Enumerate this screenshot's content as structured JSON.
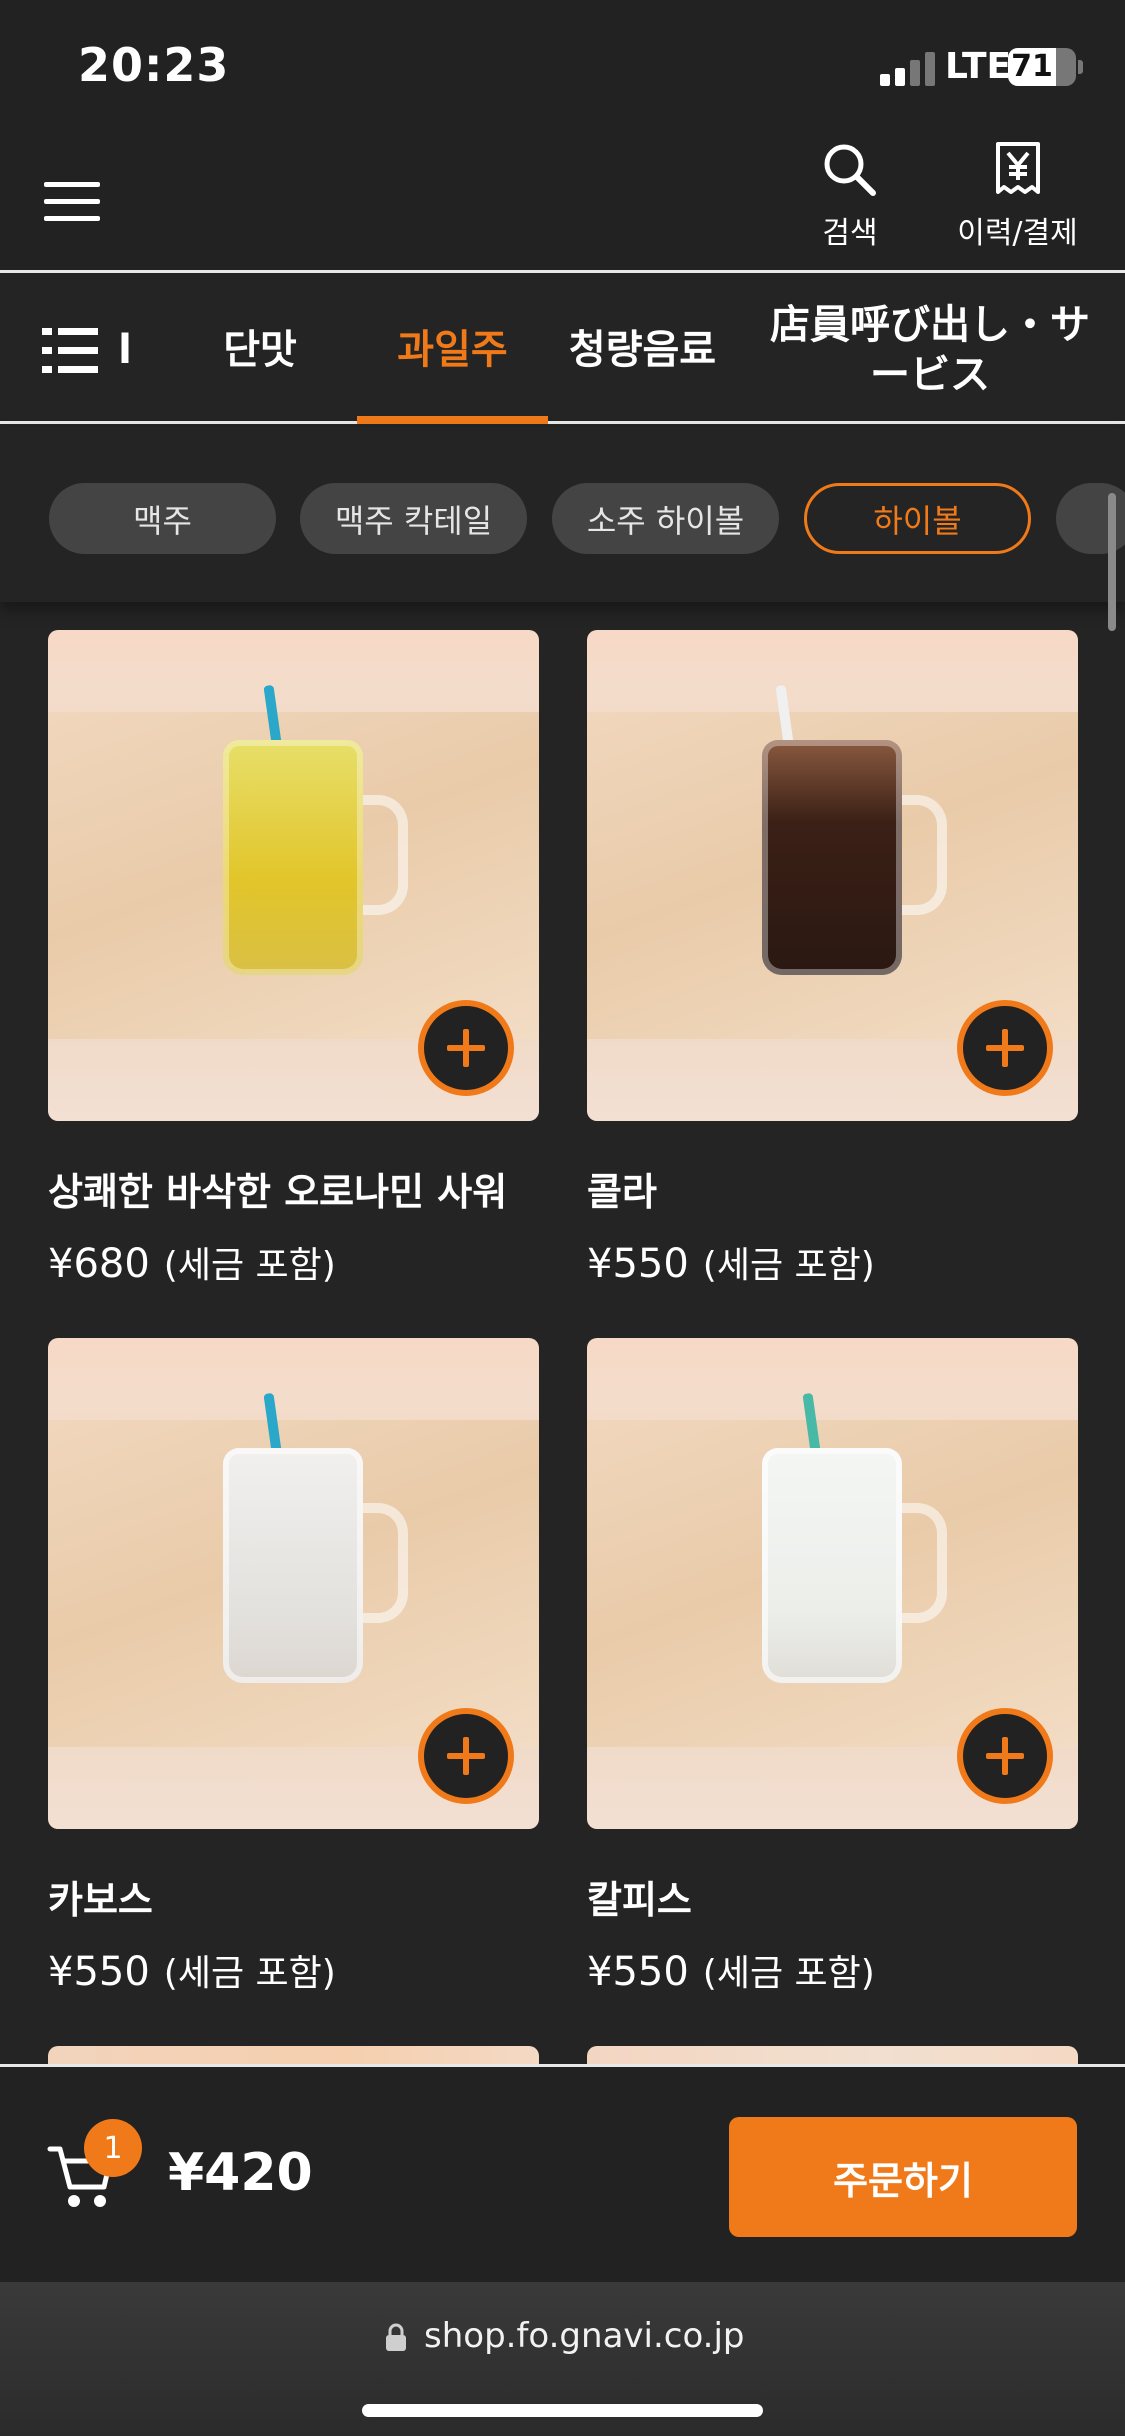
{
  "status_bar": {
    "time": "20:23",
    "network": "LTE",
    "battery": "71",
    "battery_level": 0.71
  },
  "header": {
    "search_label": "검색",
    "history_label": "이력/결제"
  },
  "tabs": {
    "partial_label": "l",
    "items": [
      "단맛",
      "과일주",
      "청량음료",
      "店員呼び出し・サービス"
    ],
    "active_index": 1
  },
  "chips": {
    "items": [
      "맥주",
      "맥주 칵테일",
      "소주 하이볼",
      "하이볼"
    ],
    "active_index": 3
  },
  "products": [
    {
      "name": "상쾌한 바삭한 오로나민 사워",
      "price": "¥680",
      "tax": "(세금 포함)"
    },
    {
      "name": "콜라",
      "price": "¥550",
      "tax": "(세금 포함)"
    },
    {
      "name": "카보스",
      "price": "¥550",
      "tax": "(세금 포함)"
    },
    {
      "name": "칼피스",
      "price": "¥550",
      "tax": "(세금 포함)"
    }
  ],
  "cart": {
    "count": "1",
    "total": "¥420",
    "order_label": "주문하기"
  },
  "browser": {
    "url": "shop.fo.gnavi.co.jp"
  },
  "colors": {
    "accent": "#f07a1a",
    "background": "#242424"
  }
}
